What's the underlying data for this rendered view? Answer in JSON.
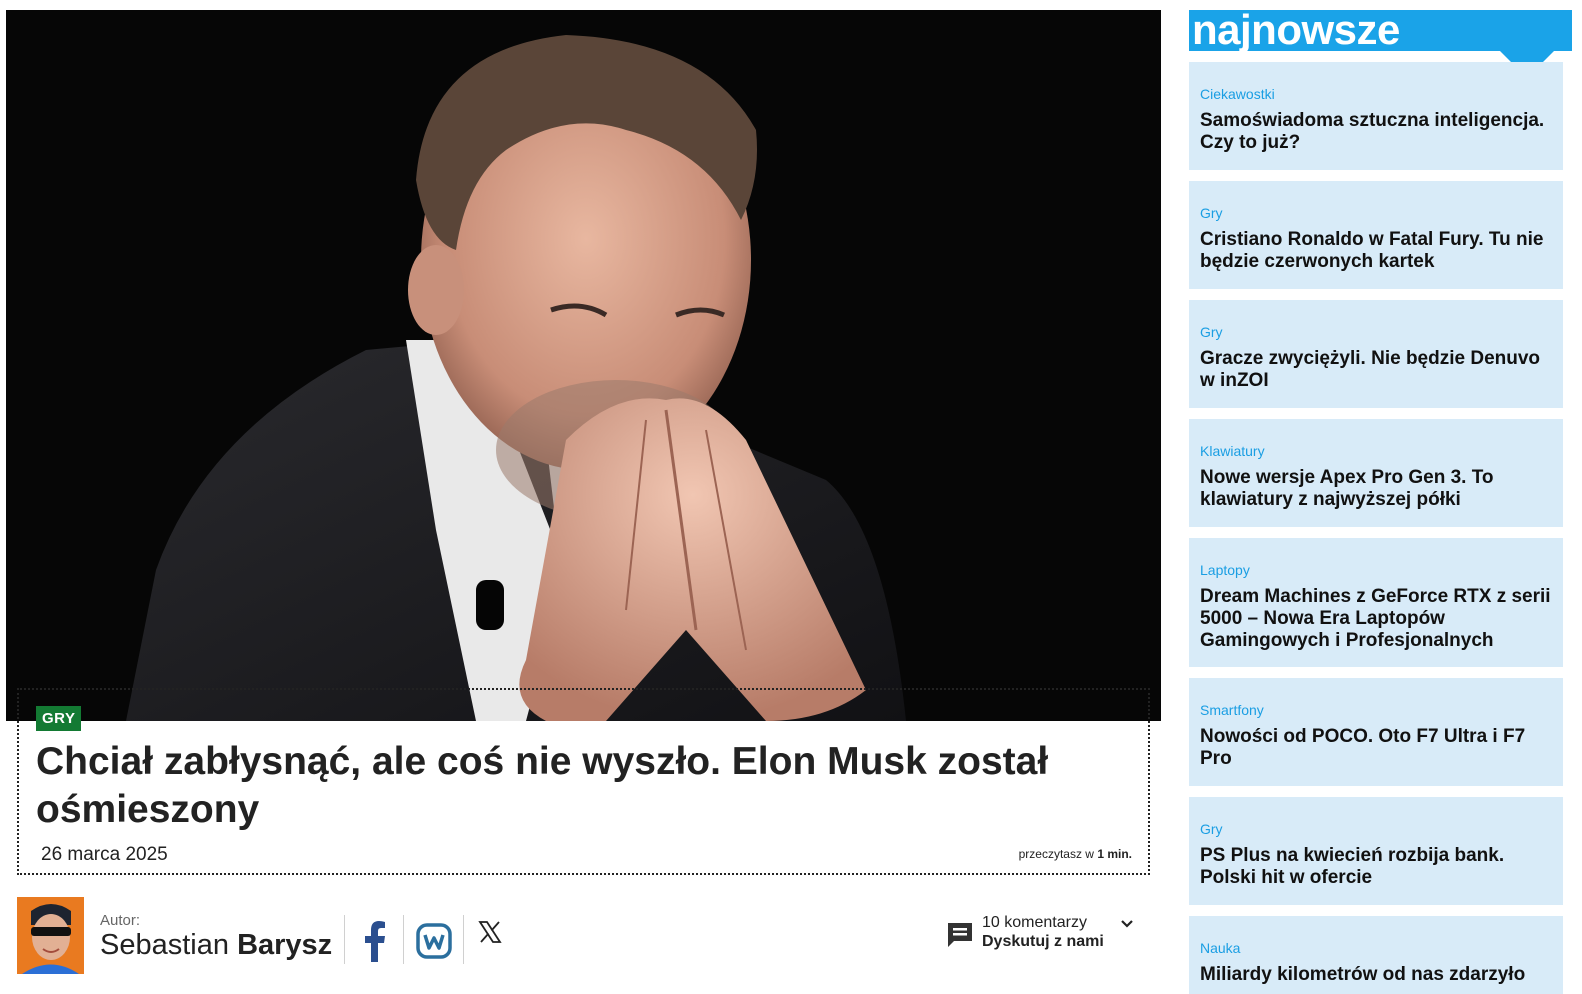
{
  "article": {
    "category": "GRY",
    "title": "Chciał zabłysnąć, ale coś nie wyszło. Elon Musk został ośmieszony",
    "date": "26 marca 2025",
    "read_time_prefix": "przeczytasz w",
    "read_time_value": "1 min."
  },
  "author": {
    "label": "Autor:",
    "first_name": "Sebastian",
    "last_name": "Barysz"
  },
  "share": {
    "facebook_icon": "facebook-icon",
    "wykop_icon": "wykop-icon",
    "x_icon": "x-icon"
  },
  "comments": {
    "count_text": "10 komentarzy",
    "cta": "Dyskutuj z nami"
  },
  "sidebar": {
    "title": "najnowsze",
    "items": [
      {
        "category": "Ciekawostki",
        "title": "Samoświadoma sztuczna inteligencja. Czy to już?"
      },
      {
        "category": "Gry",
        "title": "Cristiano Ronaldo w Fatal Fury. Tu nie będzie czerwonych kartek"
      },
      {
        "category": "Gry",
        "title": "Gracze zwyciężyli. Nie będzie Denuvo w inZOI"
      },
      {
        "category": "Klawiatury",
        "title": "Nowe wersje Apex Pro Gen 3. To klawiatury z najwyższej półki"
      },
      {
        "category": "Laptopy",
        "title": "Dream Machines z GeForce RTX z serii 5000 – Nowa Era Laptopów Gamingowych i Profesjonalnych"
      },
      {
        "category": "Smartfony",
        "title": "Nowości od POCO. Oto F7 Ultra i F7 Pro"
      },
      {
        "category": "Gry",
        "title": "PS Plus na kwiecień rozbija bank. Polski hit w ofercie"
      },
      {
        "category": "Nauka",
        "title": "Miliardy kilometrów od nas zdarzyło"
      }
    ]
  },
  "colors": {
    "accent_blue": "#1aa3e8",
    "card_bg": "#d8ebf8",
    "badge_green": "#137a33",
    "facebook_blue": "#2b4f8f"
  }
}
